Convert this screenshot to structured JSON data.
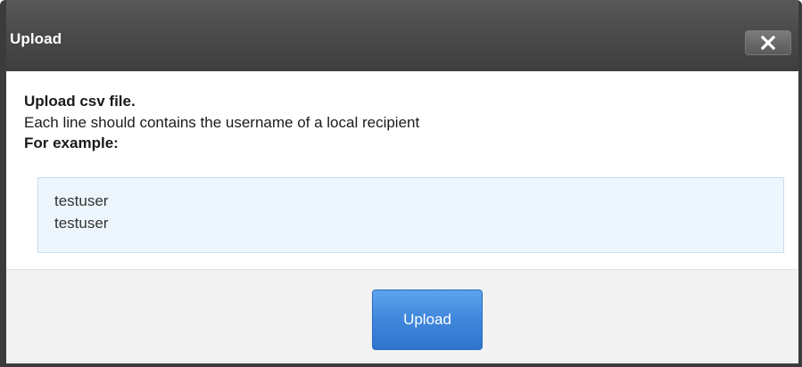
{
  "dialog": {
    "title": "Upload",
    "close_icon": "close-icon"
  },
  "content": {
    "heading": "Upload csv file.",
    "description": "Each line should contains the username of a local recipient",
    "example_label": "For example:",
    "example_lines": [
      "testuser",
      "testuser"
    ]
  },
  "footer": {
    "upload_label": "Upload"
  }
}
